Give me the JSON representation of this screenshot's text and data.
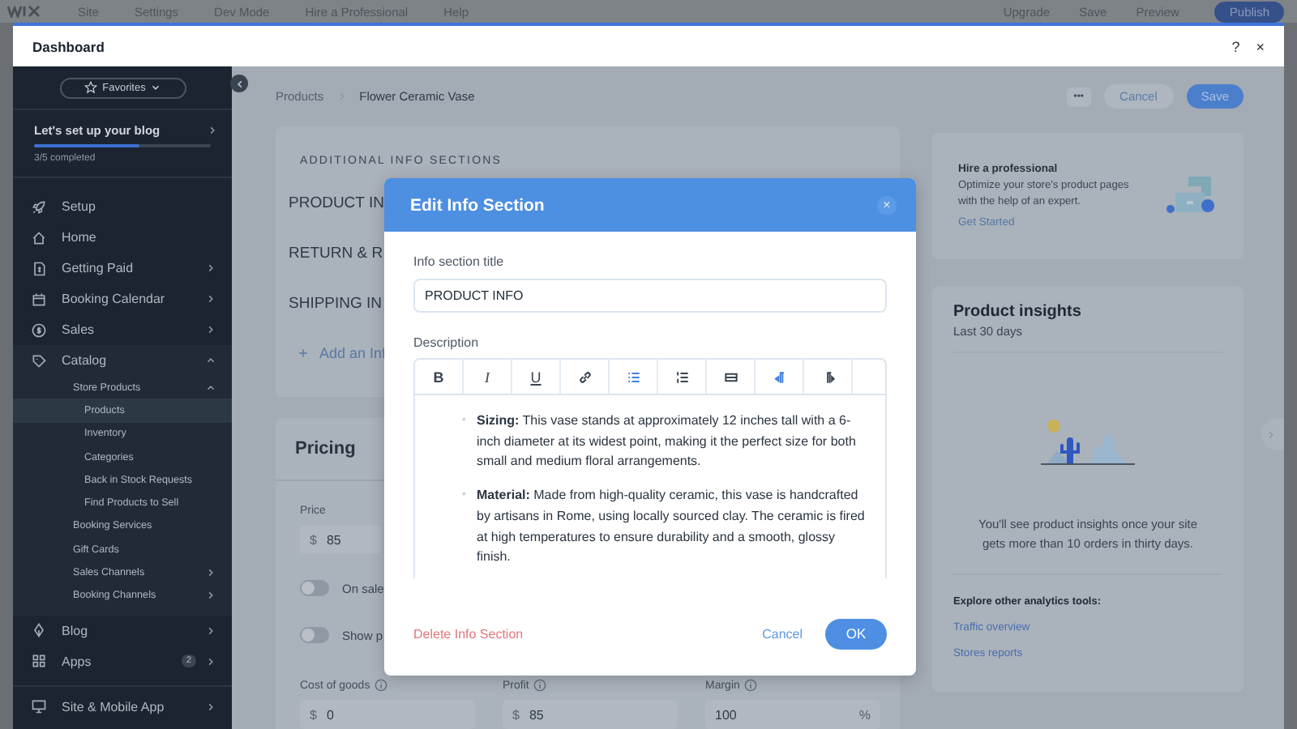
{
  "editor_bar": {
    "menu": [
      "Site",
      "Settings",
      "Dev Mode",
      "Hire a Professional",
      "Help"
    ],
    "actions": [
      "Upgrade",
      "Save",
      "Preview"
    ],
    "publish": "Publish"
  },
  "window": {
    "title": "Dashboard",
    "help": "?",
    "close": "×"
  },
  "sidebar": {
    "favorites": "Favorites",
    "setup_title": "Let's set up your blog",
    "progress": {
      "level": 0.6,
      "label": "3/5 completed"
    },
    "items": [
      {
        "label": "Setup",
        "selected": false
      },
      {
        "label": "Home",
        "selected": false
      },
      {
        "label": "Getting Paid",
        "selected": false,
        "expanded": false
      },
      {
        "label": "Booking Calendar",
        "selected": false,
        "expanded": false
      },
      {
        "label": "Sales",
        "selected": false,
        "expanded": false
      },
      {
        "label": "Catalog",
        "selected": false,
        "expanded": true,
        "children": [
          {
            "label": "Store Products",
            "selected": false,
            "expanded": true,
            "children": [
              {
                "label": "Products",
                "selected": true
              },
              {
                "label": "Inventory",
                "selected": false
              },
              {
                "label": "Categories",
                "selected": false
              },
              {
                "label": "Back in Stock Requests",
                "selected": false
              },
              {
                "label": "Find Products to Sell",
                "selected": false
              }
            ]
          },
          {
            "label": "Booking Services",
            "selected": false
          },
          {
            "label": "Gift Cards",
            "selected": false
          },
          {
            "label": "Sales Channels",
            "selected": false,
            "expanded": false
          },
          {
            "label": "Booking Channels",
            "selected": false,
            "expanded": false
          }
        ]
      },
      {
        "label": "Blog",
        "selected": false,
        "expanded": false
      },
      {
        "label": "Apps",
        "selected": false,
        "expanded": false,
        "badge": "2"
      }
    ],
    "footer_items": [
      {
        "label": "Site & Mobile App",
        "selected": false,
        "expanded": false
      }
    ]
  },
  "breadcrumb": [
    "Products",
    "Flower Ceramic Vase"
  ],
  "page_actions": {
    "more": "•••",
    "cancel": "Cancel",
    "save": "Save"
  },
  "info_sections": {
    "title": "ADDITIONAL INFO SECTIONS",
    "rows": [
      "PRODUCT IN",
      "RETURN & R",
      "SHIPPING IN"
    ],
    "add": "Add an Inf"
  },
  "pricing": {
    "title": "Pricing",
    "price_label": "Price",
    "price_prefix": "$",
    "price": "85",
    "toggles": [
      {
        "label": "On sale",
        "on": false
      },
      {
        "label": "Show p",
        "on": false
      }
    ],
    "fields": [
      {
        "label": "Cost of goods",
        "prefix": "$",
        "value": "0"
      },
      {
        "label": "Profit",
        "prefix": "$",
        "value": "85"
      },
      {
        "label": "Margin",
        "value": "100",
        "suffix": "%"
      }
    ]
  },
  "hire": {
    "title": "Hire a professional",
    "text": "Optimize your store's product pages with the help of an expert.",
    "link": "Get Started"
  },
  "insights": {
    "title": "Product insights",
    "subtitle": "Last 30 days",
    "message": "You'll see product insights once your site gets more than 10 orders in thirty days.",
    "explore_title": "Explore other analytics tools:",
    "links": [
      "Traffic overview",
      "Stores reports"
    ]
  },
  "dialog": {
    "title": "Edit Info Section",
    "close": "×",
    "title_label": "Info section title",
    "title_value": "PRODUCT INFO",
    "description_label": "Description",
    "toolbar": [
      {
        "kind": "bold",
        "label": "B",
        "active": false
      },
      {
        "kind": "italic",
        "label": "I",
        "active": false
      },
      {
        "kind": "underline",
        "label": "U",
        "active": false
      },
      {
        "kind": "link",
        "active": false
      },
      {
        "kind": "bullets",
        "active": true
      },
      {
        "kind": "numbers",
        "active": false
      },
      {
        "kind": "block",
        "active": false
      },
      {
        "kind": "ltr",
        "active": true
      },
      {
        "kind": "rtl",
        "active": false
      }
    ],
    "bullet": "◦",
    "content": [
      "**Sizing:** This vase stands at approximately 12 inches tall with a 6-inch diameter at its widest point, making it the perfect size for both small and medium floral arrangements.",
      "**Material:** Made from high-quality ceramic, this vase is handcrafted by artisans in Rome, using locally sourced clay. The ceramic is fired at high temperatures to ensure durability and a smooth, glossy finish."
    ],
    "delete": "Delete Info Section",
    "cancel": "Cancel",
    "ok": "OK"
  }
}
